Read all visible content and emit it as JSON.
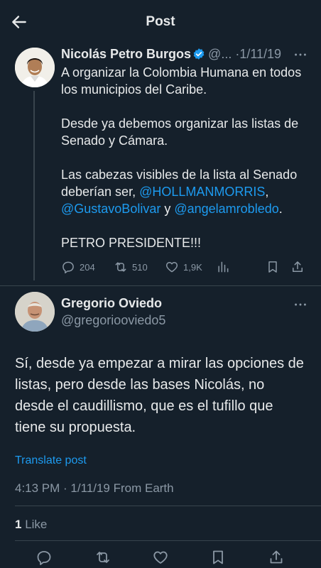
{
  "header": {
    "title": "Post",
    "back_icon": "arrow-left-icon"
  },
  "tweet1": {
    "name": "Nicolás Petro Burgos",
    "handle": "@...",
    "separator": "·",
    "date": "1/11/19",
    "paragraphs": {
      "p1": "A organizar la Colombia Humana en todos los municipios del Caribe.",
      "p2": "Desde ya debemos organizar las listas de Senado y Cámara.",
      "p3_before": "Las cabezas visibles de la lista al Senado deberían ser,",
      "mention1": "@HOLLMANMORRIS",
      "comma": ",",
      "mention2": "@GustavoBolivar",
      "y": "y",
      "mention3": "@angelamrobledo",
      "dot": ".",
      "p4": "PETRO PRESIDENTE!!!"
    },
    "replies": "204",
    "retweets": "510",
    "likes": "1,9K"
  },
  "tweet2": {
    "name": "Gregorio Oviedo",
    "handle": "@gregoriooviedo5",
    "text": "Sí, desde ya empezar a mirar las opciones de listas, pero desde las bases Nicolás, no desde el caudillismo, que es el tufillo que tiene su propuesta.",
    "translate": "Translate post",
    "meta": "4:13 PM · 1/11/19 From Earth",
    "like_count": "1",
    "like_label": "Like"
  },
  "colors": {
    "background": "#15202b",
    "text": "#e7e9ea",
    "muted": "#8b98a5",
    "link": "#1d9bf0",
    "verified": "#1d9bf0"
  }
}
